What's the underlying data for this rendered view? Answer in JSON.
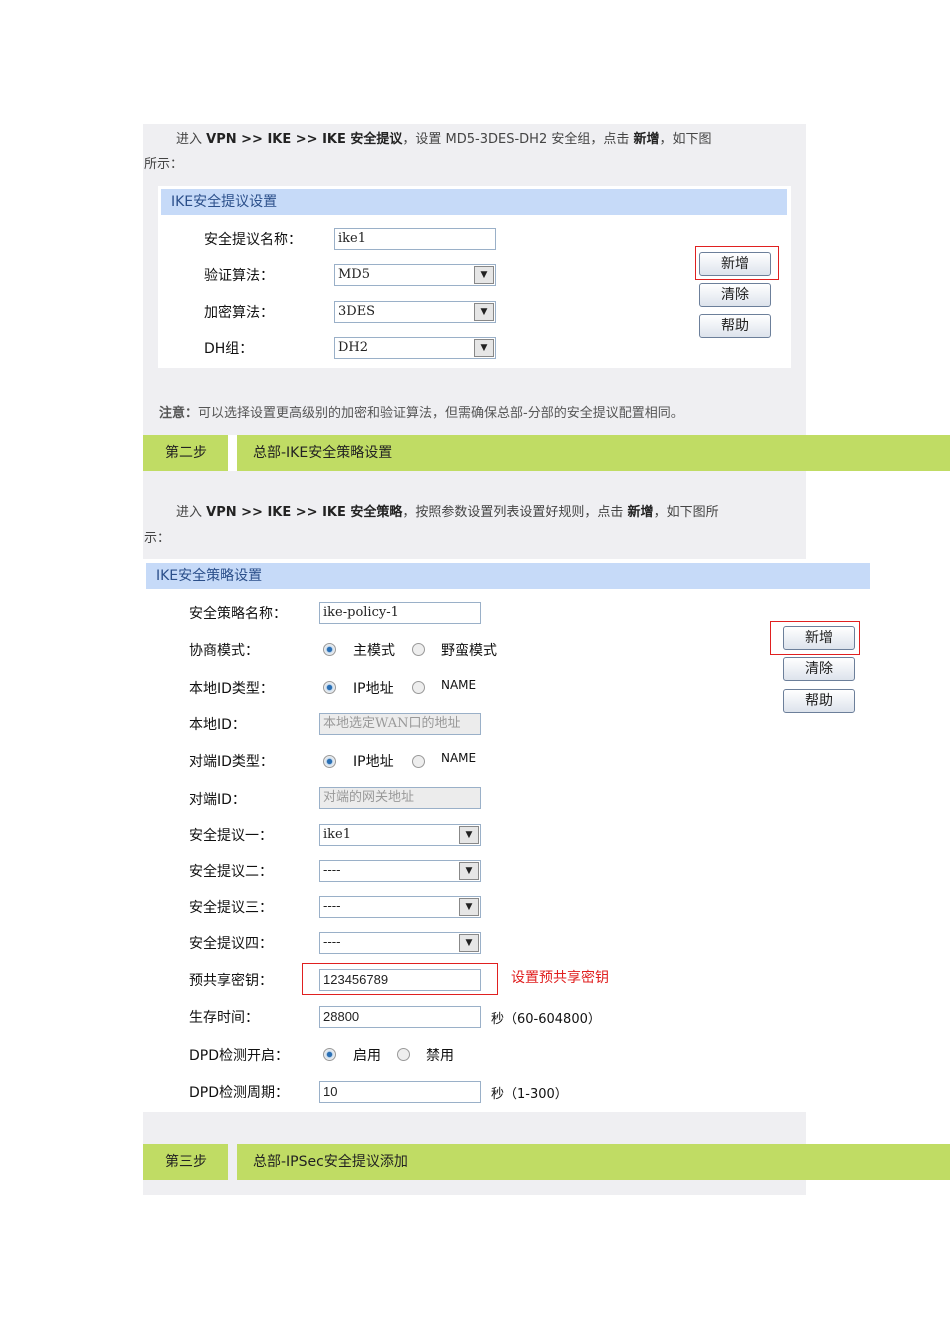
{
  "step1": {
    "intro_pre": "进入 ",
    "intro_path": "VPN >> IKE >> IKE 安全提议",
    "intro_mid": "，设置 MD5-3DES-DH2 安全组，点击 ",
    "intro_btn": "新增",
    "intro_post": "，如下图",
    "intro_line2": "所示：",
    "panel_title": "IKE安全提议设置",
    "fields": [
      {
        "label": "安全提议名称：",
        "value": "ike1"
      },
      {
        "label": "验证算法：",
        "value": "MD5"
      },
      {
        "label": "加密算法：",
        "value": "3DES"
      },
      {
        "label": "DH组：",
        "value": "DH2"
      }
    ],
    "buttons": {
      "add": "新增",
      "clear": "清除",
      "help": "帮助"
    },
    "note_label": "注意：",
    "note": "可以选择设置更高级别的加密和验证算法，但需确保总部-分部的安全提议配置相同。"
  },
  "step2": {
    "step_label": "第二步",
    "step_title": "总部-IKE安全策略设置",
    "intro_pre": "进入 ",
    "intro_path": "VPN >> IKE >> IKE 安全策略",
    "intro_mid": "，按照参数设置列表设置好规则，点击 ",
    "intro_btn": "新增",
    "intro_post": "，如下图所",
    "intro_line2": "示：",
    "panel_title": "IKE安全策略设置",
    "fields": {
      "name": {
        "label": "安全策略名称：",
        "value": "ike-policy-1"
      },
      "mode": {
        "label": "协商模式：",
        "opt1": "主模式",
        "opt2": "野蛮模式"
      },
      "local_type": {
        "label": "本地ID类型：",
        "opt1": "IP地址",
        "opt2": "NAME"
      },
      "local_id": {
        "label": "本地ID：",
        "value": "本地选定WAN口的地址"
      },
      "peer_type": {
        "label": "对端ID类型：",
        "opt1": "IP地址",
        "opt2": "NAME"
      },
      "peer_id": {
        "label": "对端ID：",
        "value": "对端的网关地址"
      },
      "p1": {
        "label": "安全提议一：",
        "value": "ike1"
      },
      "p2": {
        "label": "安全提议二：",
        "value": "----"
      },
      "p3": {
        "label": "安全提议三：",
        "value": "----"
      },
      "p4": {
        "label": "安全提议四：",
        "value": "----"
      },
      "psk": {
        "label": "预共享密钥：",
        "value": "123456789",
        "annotation": "设置预共享密钥"
      },
      "lifetime": {
        "label": "生存时间：",
        "value": "28800",
        "unit": "秒（60-604800）"
      },
      "dpd": {
        "label": "DPD检测开启：",
        "opt1": "启用",
        "opt2": "禁用"
      },
      "dpd_period": {
        "label": "DPD检测周期：",
        "value": "10",
        "unit": "秒（1-300）"
      }
    },
    "buttons": {
      "add": "新增",
      "clear": "清除",
      "help": "帮助"
    }
  },
  "step3": {
    "step_label": "第三步",
    "step_title": "总部-IPSec安全提议添加"
  }
}
